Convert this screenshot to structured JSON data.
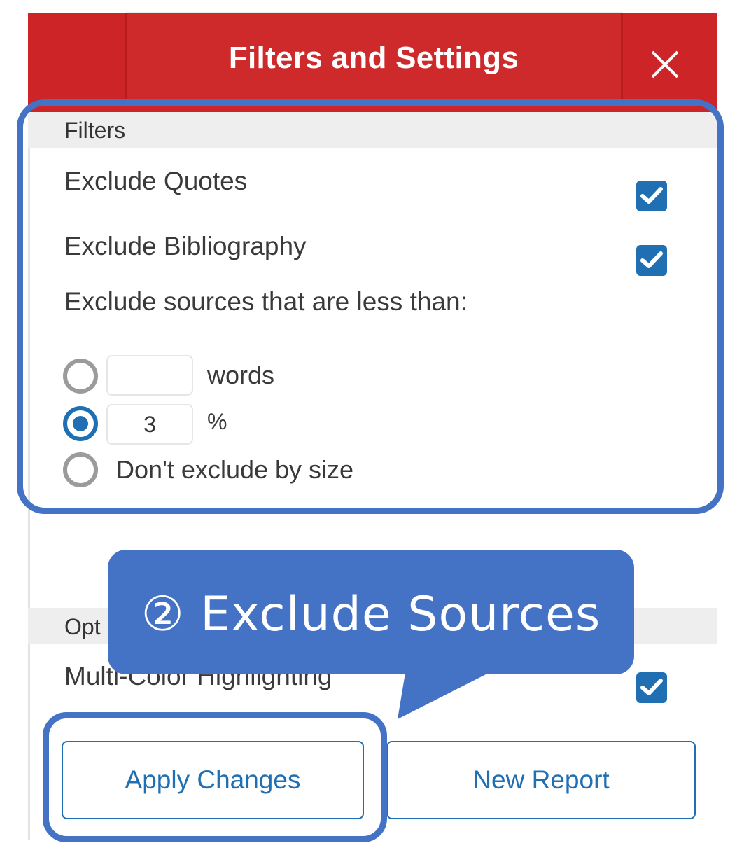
{
  "header": {
    "title": "Filters and Settings",
    "close_icon": "close-icon"
  },
  "filters": {
    "section_label": "Filters",
    "exclude_quotes": {
      "label": "Exclude Quotes",
      "checked": true
    },
    "exclude_bibliography": {
      "label": "Exclude Bibliography",
      "checked": true
    },
    "size_prompt": "Exclude sources that are less than:",
    "size_options": {
      "words": {
        "unit": "words",
        "value": "",
        "selected": false
      },
      "percent": {
        "unit": "%",
        "value": "3",
        "selected": true
      },
      "none": {
        "label": "Don't exclude by size",
        "selected": false
      }
    }
  },
  "options": {
    "section_label": "Opt",
    "multi_color": {
      "label": "Multi-Color Highlighting",
      "checked": true
    }
  },
  "buttons": {
    "apply": "Apply Changes",
    "new_report": "New Report"
  },
  "callout": {
    "text": "② Exclude Sources"
  },
  "colors": {
    "header_red": "#cc2427",
    "accent_blue": "#1f6fb2",
    "annotation_blue": "#4472c4"
  }
}
